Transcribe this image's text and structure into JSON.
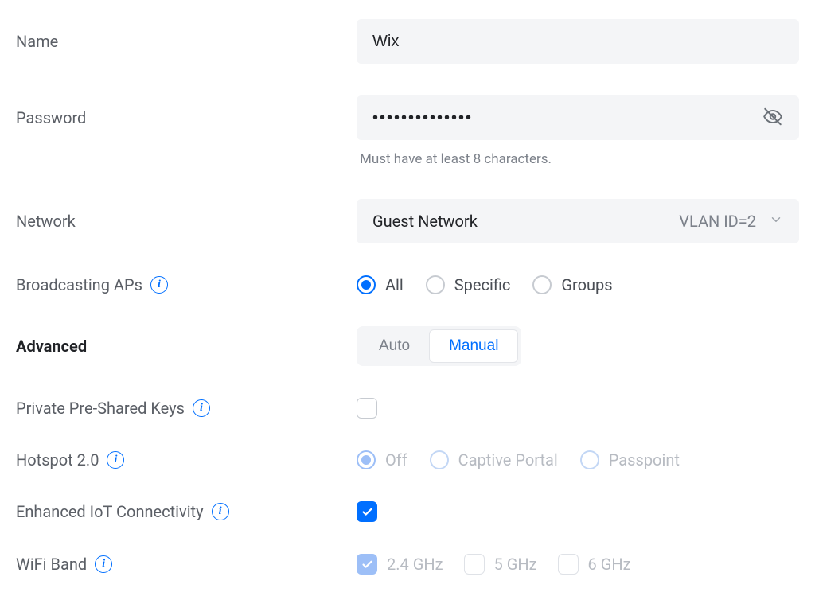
{
  "name": {
    "label": "Name",
    "value": "Wix"
  },
  "password": {
    "label": "Password",
    "value": "••••••••••••••",
    "hint": "Must have at least 8 characters."
  },
  "network": {
    "label": "Network",
    "value": "Guest Network",
    "vlan_text": "VLAN ID=2"
  },
  "broadcasting": {
    "label": "Broadcasting APs",
    "options": {
      "all": "All",
      "specific": "Specific",
      "groups": "Groups"
    },
    "selected": "all"
  },
  "advanced": {
    "label": "Advanced",
    "auto": "Auto",
    "manual": "Manual",
    "selected": "manual"
  },
  "ppsk": {
    "label": "Private Pre-Shared Keys",
    "checked": false
  },
  "hotspot": {
    "label": "Hotspot 2.0",
    "options": {
      "off": "Off",
      "captive": "Captive Portal",
      "passpoint": "Passpoint"
    },
    "selected": "off",
    "disabled": true
  },
  "iot": {
    "label": "Enhanced IoT Connectivity",
    "checked": true
  },
  "wifi_band": {
    "label": "WiFi Band",
    "options": {
      "b24": "2.4 GHz",
      "b5": "5 GHz",
      "b6": "6 GHz"
    },
    "checked_24": true,
    "disabled": true
  },
  "icons": {
    "info_glyph": "i"
  }
}
